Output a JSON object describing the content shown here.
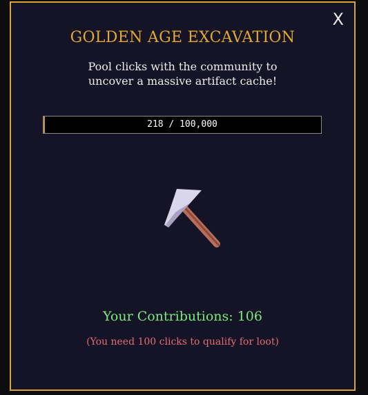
{
  "modal": {
    "title": "GOLDEN AGE EXCAVATION",
    "subtitle_line1": "Pool clicks with the community to",
    "subtitle_line2": "uncover a massive artifact cache!",
    "close_label": "X"
  },
  "progress": {
    "current": 218,
    "goal": 100000,
    "text": "218 / 100,000",
    "fraction": 0.00218
  },
  "pickaxe": {
    "icon": "pickaxe-icon"
  },
  "contributions": {
    "text": "Your Contributions: 106",
    "value": 106
  },
  "note": {
    "text": "(You need 100 clicks to qualify for loot)"
  },
  "colors": {
    "accent": "#d8a536",
    "background": "#141426",
    "contributions": "#7dea7d",
    "note": "#e46d73"
  }
}
